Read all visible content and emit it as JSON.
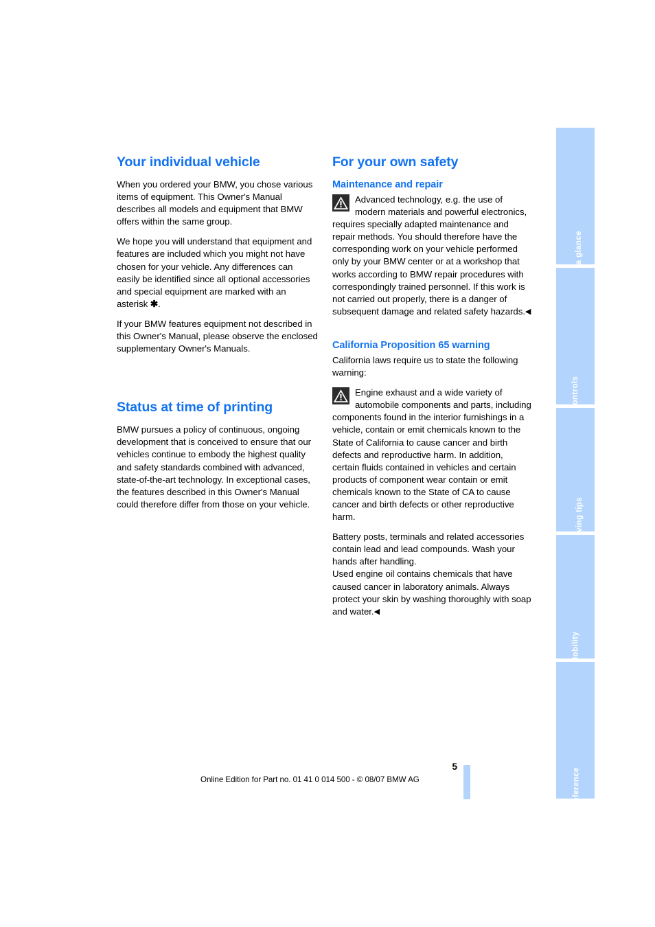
{
  "document": {
    "page_number": "5",
    "footer": "Online Edition for Part no. 01 41 0 014 500 - © 08/07 BMW AG",
    "accent_heading_color": "#1272f0",
    "tab_color": "#b3d4fc"
  },
  "left_column": {
    "sections": [
      {
        "heading": "Your individual vehicle",
        "paragraphs": [
          "When you ordered your BMW, you chose various items of equipment. This Owner's Manual describes all models and equipment that BMW offers within the same group.",
          "We hope you will understand that equipment and features are included which you might not have chosen for your vehicle. Any differences can easily be identified since all optional accessories and special equipment are marked with an asterisk ",
          "If your BMW features equipment not described in this Owner's Manual, please observe the enclosed supplementary Owner's Manuals."
        ],
        "asterisk_glyph": "✱",
        "asterisk_tail": "."
      },
      {
        "heading": "Status at time of printing",
        "paragraphs": [
          "BMW pursues a policy of continuous, ongoing development that is conceived to ensure that our vehicles continue to embody the highest quality and safety standards combined with advanced, state-of-the-art technology. In exceptional cases, the features described in this Owner's Manual could therefore differ from those on your vehicle."
        ]
      }
    ]
  },
  "right_column": {
    "heading": "For your own safety",
    "subsections": [
      {
        "subheading": "Maintenance and repair",
        "warning_text": "Advanced technology, e.g. the use of modern materials and powerful electronics, requires specially adapted maintenance and repair methods. You should therefore have the corresponding work on your vehicle performed only by your BMW center or at a workshop that works according to BMW repair procedures with correspondingly trained personnel. If this work is not carried out properly, there is a danger of subsequent damage and related safety hazards.",
        "end_mark": "◀"
      },
      {
        "subheading": "California Proposition 65 warning",
        "intro": "California laws require us to state the following warning:",
        "warning_text": "Engine exhaust and a wide variety of automobile components and parts, including components found in the interior furnishings in a vehicle, contain or emit chemicals known to the State of California to cause cancer and birth defects and reproductive harm. In addition, certain fluids contained in vehicles and certain products of component wear contain or emit chemicals known to the State of CA to cause cancer and birth defects or other reproductive harm.",
        "paragraphs": [
          "Battery posts, terminals and related accessories contain lead and lead compounds. Wash your hands after handling.",
          "Used engine oil contains chemicals that have caused cancer in laboratory animals. Always protect your skin by washing thoroughly with soap and water."
        ],
        "end_mark": "◀"
      }
    ]
  },
  "sidebar": {
    "tabs": [
      {
        "label": "At a glance"
      },
      {
        "label": "Controls"
      },
      {
        "label": "Driving tips"
      },
      {
        "label": "Mobility"
      },
      {
        "label": "Reference"
      }
    ]
  }
}
